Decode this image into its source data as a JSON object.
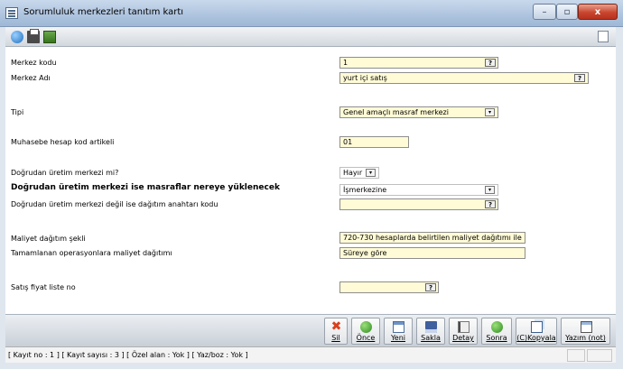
{
  "window": {
    "title": "Sorumluluk merkezleri tanıtım kartı",
    "close_glyph": "x",
    "max_glyph": "▫",
    "min_glyph": "–"
  },
  "form": {
    "merkez_kodu": {
      "label": "Merkez kodu",
      "value": "1",
      "lookup": "?"
    },
    "merkez_adi": {
      "label": "Merkez Adı",
      "value": "yurt içi satış",
      "lookup": "?"
    },
    "tipi": {
      "label": "Tipi",
      "value": "Genel amaçlı masraf merkezi"
    },
    "muhasebe": {
      "label": "Muhasebe hesap kod artikeli",
      "value": "01"
    },
    "uretim_mi": {
      "label": "Doğrudan üretim merkezi mi?",
      "value": "Hayır"
    },
    "yuklenecek": {
      "label": "Doğrudan üretim merkezi ise masraflar nereye yüklenecek",
      "value": "İşmerkezine"
    },
    "dagitim_kodu": {
      "label": "Doğrudan üretim merkezi değil ise dağıtım anahtarı kodu",
      "value": "",
      "lookup": "?"
    },
    "maliyet_sekli": {
      "label": "Maliyet dağıtım şekli",
      "value": "720-730 hesaplarda belirtilen maliyet dağıtımı ile"
    },
    "tamamlanan": {
      "label": "Tamamlanan operasyonlara maliyet dağıtımı",
      "value": "Süreye göre"
    },
    "satis_fiyat": {
      "label": "Satış fiyat liste no",
      "value": "",
      "lookup": "?"
    }
  },
  "actions": {
    "sil": "Sil",
    "once": "Önce",
    "yeni": "Yeni",
    "sakla": "Sakla",
    "detay": "Detay",
    "sonra": "Sonra",
    "kopyala": "(C)Kopyala",
    "yazim": "Yazım (not)"
  },
  "status": {
    "text": "[ Kayıt no : 1 ] [ Kayıt sayısı : 3 ] [ Özel alan : Yok ] [ Yaz/boz : Yok ]"
  },
  "icons": {
    "toolbar": [
      "globe-icon",
      "print-icon",
      "export-icon"
    ],
    "dropdown_glyph": "▾"
  },
  "colors": {
    "field_bg": "#fffbd6",
    "close_btn": "#c9462f",
    "titlebar": "#adc3de"
  }
}
